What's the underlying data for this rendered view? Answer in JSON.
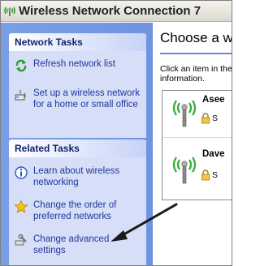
{
  "window": {
    "title": "Wireless Network Connection 7",
    "icon": "wireless-connection-icon"
  },
  "network_tasks": {
    "header": "Network Tasks",
    "items": [
      {
        "label": "Refresh network list",
        "icon": "refresh-icon"
      },
      {
        "label": "Set up a wireless network for a home or small office",
        "icon": "setup-network-icon"
      }
    ]
  },
  "related_tasks": {
    "header": "Related Tasks",
    "items": [
      {
        "label": "Learn about wireless networking",
        "icon": "info-icon"
      },
      {
        "label": "Change the order of preferred networks",
        "icon": "star-icon"
      },
      {
        "label": "Change advanced settings",
        "icon": "wrench-settings-icon"
      }
    ]
  },
  "main": {
    "title": "Choose a w",
    "info_line1": "Click an item in the",
    "info_line2": "information."
  },
  "networks": [
    {
      "name": "Asee",
      "security": "S"
    },
    {
      "name": "Dave",
      "security": "S"
    }
  ],
  "colors": {
    "taskpane": "#7b9fe6",
    "group_body": "#d6dff7",
    "group_header_text": "#10246f",
    "link_text": "#21379b",
    "content_divider": "#6d89d2",
    "signal_green": "#3cb043"
  }
}
